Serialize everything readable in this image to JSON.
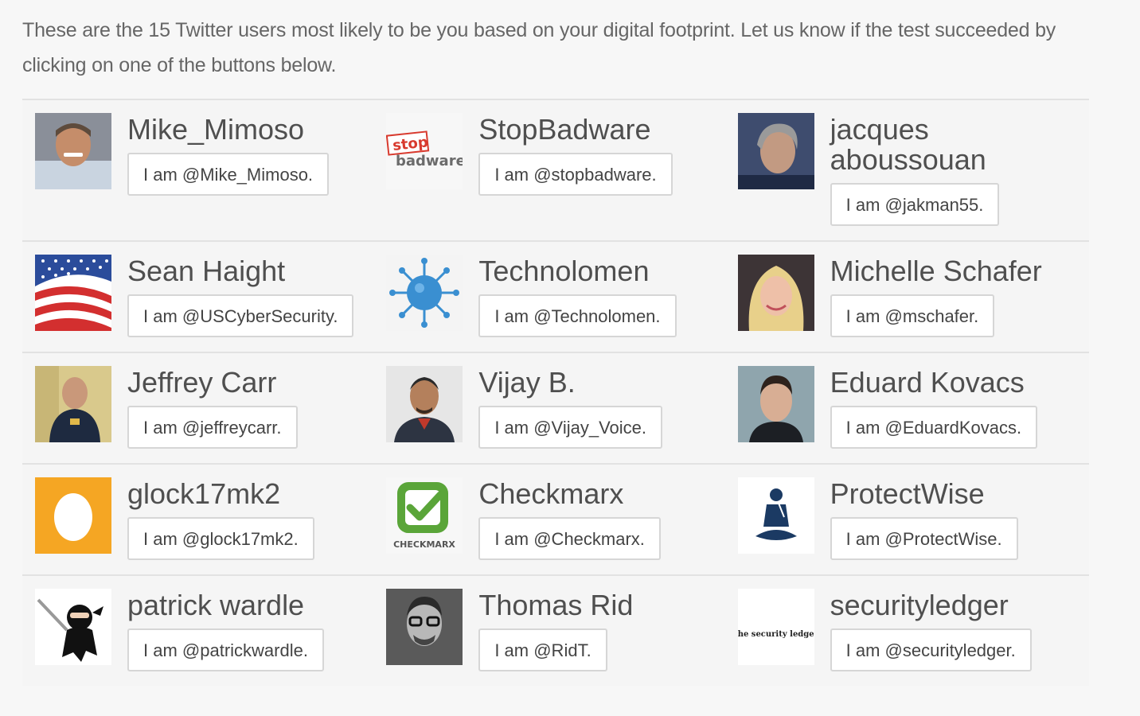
{
  "intro": "These are the 15 Twitter users most likely to be you based on your digital footprint. Let us know if the test succeeded by clicking on one of the buttons below.",
  "users": [
    {
      "name": "Mike_Mimoso",
      "button": "I am @Mike_Mimoso.",
      "avatar": "man-portrait-photo"
    },
    {
      "name": "StopBadware",
      "button": "I am @stopbadware.",
      "avatar": "stopbadware-logo",
      "logo_text_top": "stop",
      "logo_text_bottom": "badware"
    },
    {
      "name": "jacques aboussouan",
      "button": "I am @jakman55.",
      "avatar": "man-portrait-photo"
    },
    {
      "name": "Sean Haight",
      "button": "I am @USCyberSecurity.",
      "avatar": "us-flag-image"
    },
    {
      "name": "Technolomen",
      "button": "I am @Technolomen.",
      "avatar": "virus-image"
    },
    {
      "name": "Michelle Schafer",
      "button": "I am @mschafer.",
      "avatar": "woman-portrait-photo"
    },
    {
      "name": "Jeffrey Carr",
      "button": "I am @jeffreycarr.",
      "avatar": "man-speaking-photo"
    },
    {
      "name": "Vijay B.",
      "button": "I am @Vijay_Voice.",
      "avatar": "man-portrait-photo"
    },
    {
      "name": "Eduard Kovacs",
      "button": "I am @EduardKovacs.",
      "avatar": "man-portrait-photo"
    },
    {
      "name": "glock17mk2",
      "button": "I am @glock17mk2.",
      "avatar": "default-egg-avatar"
    },
    {
      "name": "Checkmarx",
      "button": "I am @Checkmarx.",
      "avatar": "checkmarx-logo",
      "logo_text": "CHECKMARX"
    },
    {
      "name": "ProtectWise",
      "button": "I am @ProtectWise.",
      "avatar": "protectwise-logo"
    },
    {
      "name": "patrick wardle",
      "button": "I am @patrickwardle.",
      "avatar": "ninja-image"
    },
    {
      "name": "Thomas Rid",
      "button": "I am @RidT.",
      "avatar": "man-portrait-photo"
    },
    {
      "name": "securityledger",
      "button": "I am @securityledger.",
      "avatar": "securityledger-logo",
      "logo_text": "the security ledger"
    }
  ],
  "colors": {
    "egg_bg": "#f5a623",
    "checkmarx_green": "#5aa539",
    "virus_blue": "#3a8fd1",
    "stop_red": "#d83a2e"
  }
}
